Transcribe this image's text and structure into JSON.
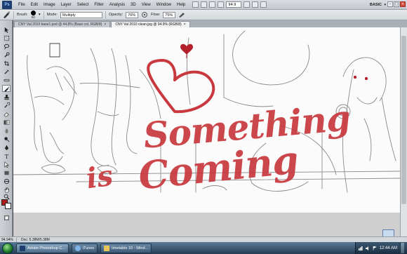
{
  "app_bar": {
    "logo": "Ps",
    "menu": [
      "File",
      "Edit",
      "Image",
      "Layer",
      "Select",
      "Filter",
      "Analysis",
      "3D",
      "View",
      "Window",
      "Help"
    ],
    "zoom_value": "94.9",
    "workspace": "BASIC",
    "workspace_arrow": "▾"
  },
  "options": {
    "brush_label": "Brush:",
    "brush_size": "60",
    "mode_label": "Mode:",
    "mode_value": "Multiply",
    "opacity_label": "Opacity:",
    "opacity_value": "76%",
    "flow_label": "Flow:",
    "flow_value": "75%"
  },
  "tabs": [
    {
      "label": "CNY Val 2010 base1.psd @ 44.8% (Base col, RGB/8)",
      "close": "×"
    },
    {
      "label": "CNY Val 2010 clean.jpg @ 94.9% (RGB/8)",
      "close": "×"
    }
  ],
  "artwork": {
    "text_line1": "Something",
    "text_line2": "is",
    "text_line3": "Coming",
    "ink_color": "#c8383e"
  },
  "status": {
    "zoom": "94.94%",
    "doc": "Doc: 5.38M/5.38M"
  },
  "taskbar": {
    "items": [
      {
        "label": "Adobe Photoshop C...",
        "icon_color": "#1f3d6e"
      },
      {
        "label": "iTunes",
        "icon_color": "#7fb2e5"
      },
      {
        "label": "timetable 10 - Wind...",
        "icon_color": "#e7c55a"
      }
    ],
    "clock": "12:44 AM"
  },
  "colors": {
    "foreground": "#b01c1c",
    "background": "#ffffff"
  }
}
